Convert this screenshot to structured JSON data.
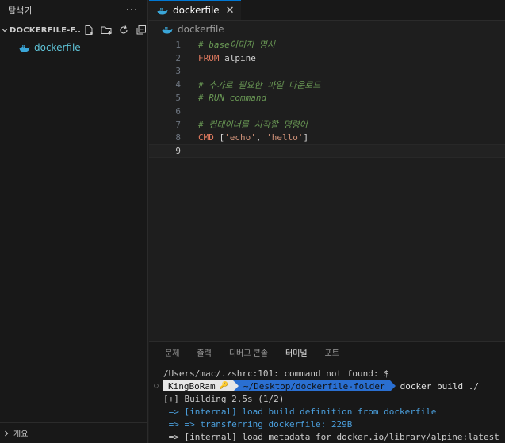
{
  "sidebar": {
    "title": "탐색기",
    "more": "···",
    "folder_name": "DOCKERFILE-F...",
    "file_name": "dockerfile",
    "outline_label": "개요"
  },
  "tab": {
    "label": "dockerfile",
    "close": "✕"
  },
  "breadcrumb": {
    "label": "dockerfile"
  },
  "editor": {
    "current_line": 9,
    "lines": [
      {
        "n": "1",
        "segments": [
          {
            "t": "# base이미지 명시",
            "c": "comment"
          }
        ]
      },
      {
        "n": "2",
        "segments": [
          {
            "t": "FROM",
            "c": "kw"
          },
          {
            "t": " alpine",
            "c": "plain"
          }
        ]
      },
      {
        "n": "3",
        "segments": []
      },
      {
        "n": "4",
        "segments": [
          {
            "t": "# 추가로 필요한 파일 다운로드",
            "c": "comment"
          }
        ]
      },
      {
        "n": "5",
        "segments": [
          {
            "t": "# RUN command",
            "c": "comment"
          }
        ]
      },
      {
        "n": "6",
        "segments": []
      },
      {
        "n": "7",
        "segments": [
          {
            "t": "# 컨테이너를 시작할 명령어",
            "c": "comment"
          }
        ]
      },
      {
        "n": "8",
        "segments": [
          {
            "t": "CMD",
            "c": "kw"
          },
          {
            "t": " [",
            "c": "plain"
          },
          {
            "t": "'echo'",
            "c": "str"
          },
          {
            "t": ", ",
            "c": "plain"
          },
          {
            "t": "'hello'",
            "c": "str"
          },
          {
            "t": "]",
            "c": "plain"
          }
        ]
      },
      {
        "n": "9",
        "segments": []
      }
    ]
  },
  "panel": {
    "tabs": [
      "문제",
      "출력",
      "디버그 콘솔",
      "터미널",
      "포트"
    ],
    "active_tab": "터미널"
  },
  "terminal": {
    "line1": "/Users/mac/.zshrc:101: command not found: $",
    "prompt_dot": "○",
    "user": "KingBoRam",
    "key_glyph": "🔑",
    "path": "~/Desktop/dockerfile-folder",
    "command": "docker build ./",
    "build": "[+] Building 2.5s (1/2)",
    "step1": " => [internal] load build definition from dockerfile",
    "step2": " => => transferring dockerfile: 229B",
    "step3": " => [internal] load metadata for docker.io/library/alpine:latest"
  },
  "colors": {
    "accent": "#0078d4",
    "file_icon": "#3aa6d8",
    "prompt_path_bg": "#2a6fd1",
    "cursor": "#f0c66a"
  }
}
